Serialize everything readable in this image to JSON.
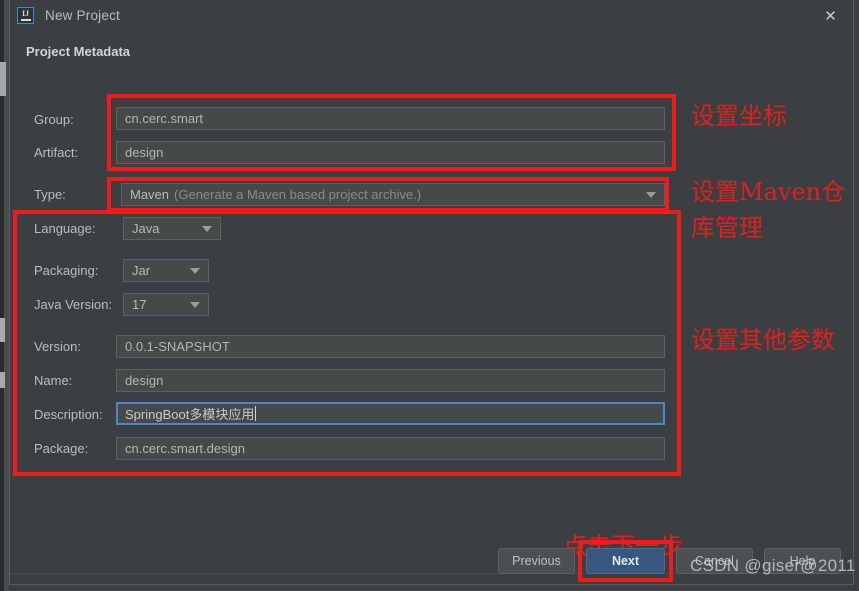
{
  "window": {
    "title": "New Project",
    "app_icon": "intellij-idea-icon",
    "close_icon": "close-icon"
  },
  "form": {
    "heading": "Project Metadata",
    "rows": [
      {
        "label": "Group:",
        "value": "cn.cerc.smart",
        "kind": "text"
      },
      {
        "label": "Artifact:",
        "value": "design",
        "kind": "text"
      },
      {
        "label": "Type:",
        "value": "Maven",
        "hint": "(Generate a Maven based project archive.)",
        "kind": "combo"
      },
      {
        "label": "Language:",
        "value": "Java",
        "kind": "combo"
      },
      {
        "label": "Packaging:",
        "value": "Jar",
        "kind": "combo"
      },
      {
        "label": "Java Version:",
        "value": "17",
        "kind": "combo"
      },
      {
        "label": "Version:",
        "value": "0.0.1-SNAPSHOT",
        "kind": "text"
      },
      {
        "label": "Name:",
        "value": "design",
        "kind": "text"
      },
      {
        "label": "Description:",
        "value": "SpringBoot多模块应用",
        "kind": "text",
        "focused": true
      },
      {
        "label": "Package:",
        "value": "cn.cerc.smart.design",
        "kind": "text"
      }
    ]
  },
  "annotations": {
    "coordinates": "设置坐标",
    "maven_line1": "设置Maven仓",
    "maven_line2": "库管理",
    "other_params": "设置其他参数",
    "next_step": "点击下一步",
    "color": "#e02020"
  },
  "buttons": {
    "previous": "Previous",
    "next": "Next",
    "cancel": "Cancel",
    "help": "Help"
  },
  "watermark": "CSDN @giser@2011"
}
